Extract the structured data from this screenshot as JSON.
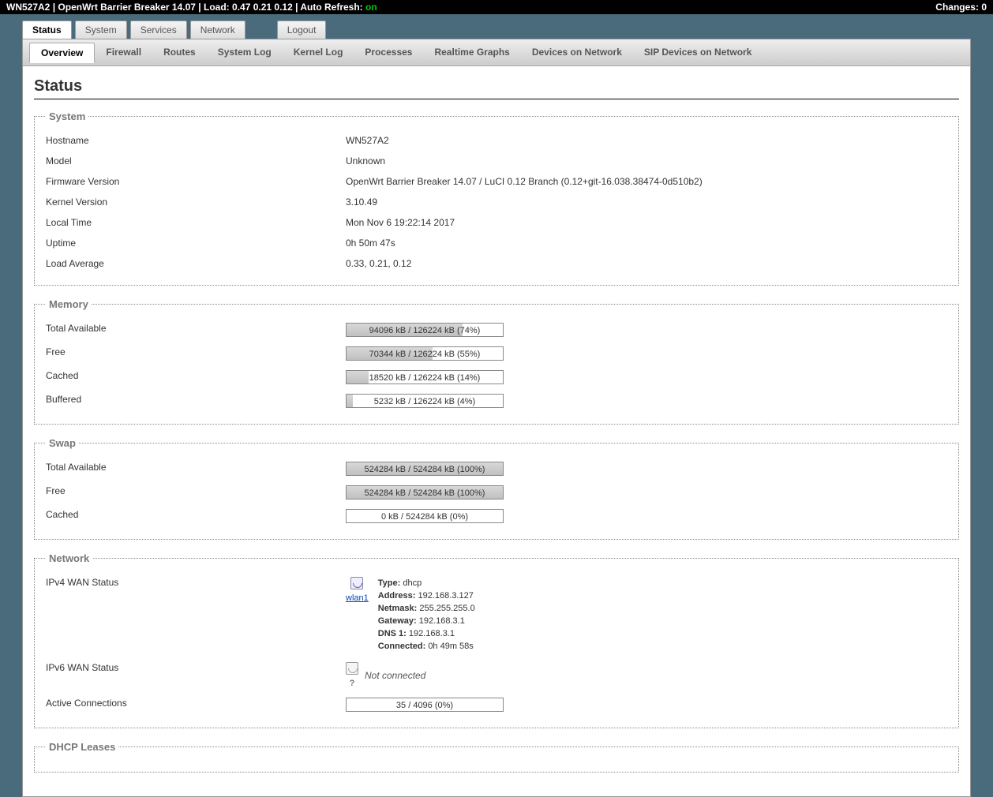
{
  "topbar": {
    "hostname": "WN527A2",
    "firmware_short": "OpenWrt Barrier Breaker 14.07",
    "load_label": "Load:",
    "load": "0.47 0.21 0.12",
    "autorefresh_label": "Auto Refresh:",
    "autorefresh": "on",
    "changes_label": "Changes:",
    "changes": "0"
  },
  "maintabs": [
    "Status",
    "System",
    "Services",
    "Network",
    "Logout"
  ],
  "subtabs": [
    "Overview",
    "Firewall",
    "Routes",
    "System Log",
    "Kernel Log",
    "Processes",
    "Realtime Graphs",
    "Devices on Network",
    "SIP Devices on Network"
  ],
  "page_title": "Status",
  "system": {
    "legend": "System",
    "rows": {
      "hostname_label": "Hostname",
      "hostname": "WN527A2",
      "model_label": "Model",
      "model": "Unknown",
      "fw_label": "Firmware Version",
      "fw": "OpenWrt Barrier Breaker 14.07 / LuCI 0.12 Branch (0.12+git-16.038.38474-0d510b2)",
      "kernel_label": "Kernel Version",
      "kernel": "3.10.49",
      "time_label": "Local Time",
      "time": "Mon Nov 6 19:22:14 2017",
      "uptime_label": "Uptime",
      "uptime": "0h 50m 47s",
      "la_label": "Load Average",
      "la": "0.33, 0.21, 0.12"
    }
  },
  "memory": {
    "legend": "Memory",
    "total_label": "Total Available",
    "total_text": "94096 kB / 126224 kB (74%)",
    "total_pct": 74,
    "free_label": "Free",
    "free_text": "70344 kB / 126224 kB (55%)",
    "free_pct": 55,
    "cached_label": "Cached",
    "cached_text": "18520 kB / 126224 kB (14%)",
    "cached_pct": 14,
    "buffered_label": "Buffered",
    "buffered_text": "5232 kB / 126224 kB (4%)",
    "buffered_pct": 4
  },
  "swap": {
    "legend": "Swap",
    "total_label": "Total Available",
    "total_text": "524284 kB / 524284 kB (100%)",
    "total_pct": 100,
    "free_label": "Free",
    "free_text": "524284 kB / 524284 kB (100%)",
    "free_pct": 100,
    "cached_label": "Cached",
    "cached_text": "0 kB / 524284 kB (0%)",
    "cached_pct": 0
  },
  "network": {
    "legend": "Network",
    "ipv4_label": "IPv4 WAN Status",
    "ipv4": {
      "iface": "wlan1",
      "type_label": "Type:",
      "type": "dhcp",
      "addr_label": "Address:",
      "addr": "192.168.3.127",
      "mask_label": "Netmask:",
      "mask": "255.255.255.0",
      "gw_label": "Gateway:",
      "gw": "192.168.3.1",
      "dns_label": "DNS 1:",
      "dns": "192.168.3.1",
      "conn_label": "Connected:",
      "conn": "0h 49m 58s"
    },
    "ipv6_label": "IPv6 WAN Status",
    "ipv6_notconn_q": "?",
    "ipv6_notconn": "Not connected",
    "ac_label": "Active Connections",
    "ac_text": "35 / 4096 (0%)",
    "ac_pct": 0
  },
  "dhcp": {
    "legend": "DHCP Leases"
  }
}
